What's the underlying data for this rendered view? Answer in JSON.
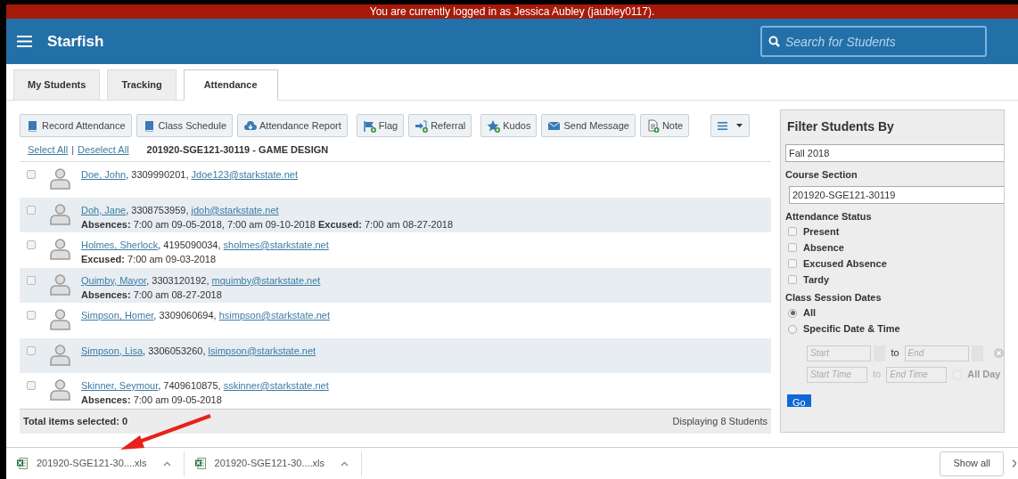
{
  "banner": "You are currently logged in as Jessica Aubley (jaubley0117).",
  "app": {
    "title": "Starfish"
  },
  "search": {
    "placeholder": "Search for Students"
  },
  "tabs": [
    {
      "label": "My Students",
      "selected": false
    },
    {
      "label": "Tracking",
      "selected": false
    },
    {
      "label": "Attendance",
      "selected": true
    }
  ],
  "toolbar": [
    {
      "label": "Record Attendance",
      "kind": "book"
    },
    {
      "label": "Class Schedule",
      "kind": "book"
    },
    {
      "label": "Attendance Report",
      "kind": "cloud"
    },
    {
      "label": "Flag",
      "kind": "flag"
    },
    {
      "label": "Referral",
      "kind": "referral"
    },
    {
      "label": "Kudos",
      "kind": "star"
    },
    {
      "label": "Send Message",
      "kind": "mail"
    },
    {
      "label": "Note",
      "kind": "note"
    }
  ],
  "selection_links": [
    "Select All",
    "Deselect All"
  ],
  "selection_separator": "|",
  "course_title": "201920-SGE121-30119 - GAME DESIGN",
  "students": [
    {
      "name": "Doe, John",
      "phone": ", 3309990201, ",
      "email": "Jdoe123@starkstate.net",
      "checked": false
    },
    {
      "name": "Doh, Jane",
      "phone": ", 3308753959, ",
      "email": "jdoh@starkstate.net",
      "checked": false,
      "details": "**Absences:** 7:00 am 09-05-2018, 7:00 am 09-10-2018 **Excused:** 7:00 am 08-27-2018"
    },
    {
      "name": "Holmes, Sherlock",
      "phone": ", 4195090034, ",
      "email": "sholmes@starkstate.net",
      "checked": false,
      "details": "**Excused:** 7:00 am 09-03-2018"
    },
    {
      "name": "Quimby, Mayor",
      "phone": ", 3303120192, ",
      "email": "mquimby@starkstate.net",
      "checked": false,
      "details": "**Absences:** 7:00 am 08-27-2018"
    },
    {
      "name": "Simpson, Homer",
      "phone": ", 3309060694, ",
      "email": "hsimpson@starkstate.net",
      "checked": false
    },
    {
      "name": "Simpson, Lisa",
      "phone": ", 3306053260, ",
      "email": "lsimpson@starkstate.net",
      "checked": false
    },
    {
      "name": "Skinner, Seymour",
      "phone": ", 7409610875, ",
      "email": "sskinner@starkstate.net",
      "checked": false,
      "details": "**Absences:** 7:00 am 09-05-2018"
    }
  ],
  "footer": {
    "total": "Total items selected: 0",
    "displaying": "Displaying 8 Students"
  },
  "filter": {
    "title": "Filter Students By",
    "term": "Fall 2018",
    "course_section_label": "Course Section",
    "course_section": "201920-SGE121-30119",
    "attendance_status_label": "Attendance Status",
    "statuses": [
      {
        "label": "Present",
        "checked": false
      },
      {
        "label": "Absence",
        "checked": false
      },
      {
        "label": "Excused Absence",
        "checked": false
      },
      {
        "label": "Tardy",
        "checked": false
      }
    ],
    "session_dates_label": "Class Session Dates",
    "session_options": [
      {
        "label": "All",
        "selected": true
      },
      {
        "label": "Specific Date & Time",
        "selected": false
      }
    ],
    "start_placeholder": "Start",
    "to_1": "to",
    "end_placeholder": "End",
    "start_time_placeholder": "Start Time",
    "to_2": "to",
    "end_time_placeholder": "End Time",
    "all_day": {
      "label": "All Day",
      "checked": false,
      "disabled": true
    },
    "go": "Go"
  },
  "downloads": [
    {
      "file": "201920-SGE121-30....xls"
    },
    {
      "file": "201920-SGE121-30....xls"
    }
  ],
  "show_all": "Show all"
}
